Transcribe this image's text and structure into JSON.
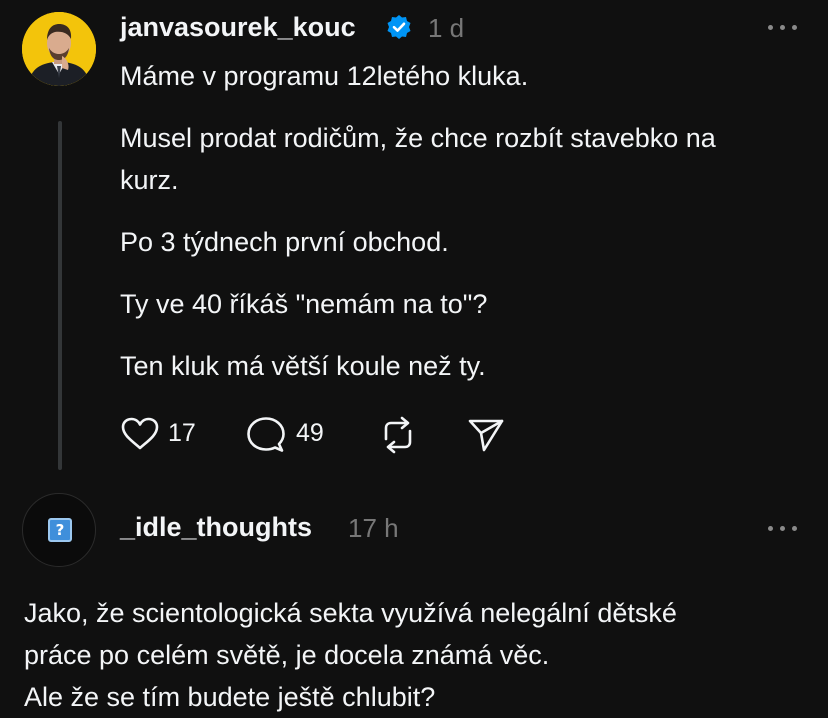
{
  "post": {
    "author": "janvasourek_kouc",
    "time": "1 d",
    "lines": [
      "Máme v programu 12letého kluka.",
      "Musel prodat rodičům, že chce rozbít stavebko na",
      "kurz.",
      "Po 3 týdnech první obchod.",
      "Ty ve 40 říkáš \"nemám na to\"?",
      "Ten kluk má větší koule než ty."
    ],
    "likes": "17",
    "comments": "49"
  },
  "reply": {
    "author": "_idle_thoughts",
    "time": "17 h",
    "avatar_glyph": "?",
    "lines": [
      "Jako, že scientologická sekta využívá nelegální dětské",
      "práce po celém světě, je docela známá věc.",
      "Ale že se tím budete ještě chlubit?"
    ]
  },
  "icons": {
    "verified": "verified-badge-icon",
    "more": "more-horizontal-icon",
    "like": "heart-icon",
    "comment": "comment-bubble-icon",
    "repost": "repost-icon",
    "share": "send-icon"
  },
  "colors": {
    "background": "#101010",
    "text": "#f3f5f7",
    "muted": "#777777",
    "verified": "#0095f6",
    "avatar_bg": "#f3c40b"
  }
}
